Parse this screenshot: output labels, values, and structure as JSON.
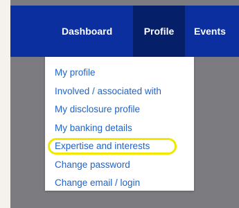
{
  "nav": {
    "items": [
      {
        "label": "Dashboard"
      },
      {
        "label": "Profile",
        "active": true
      },
      {
        "label": "Events"
      }
    ]
  },
  "profile_menu": {
    "items": [
      {
        "label": "My profile"
      },
      {
        "label": "Involved / associated with"
      },
      {
        "label": "My disclosure profile"
      },
      {
        "label": "My banking details"
      },
      {
        "label": "Expertise and interests",
        "highlighted": true
      },
      {
        "label": "Change password"
      },
      {
        "label": "Change email / login"
      }
    ]
  },
  "colors": {
    "nav_background": "#0b2f9e",
    "nav_active_background": "#061f69",
    "link": "#1f63c9",
    "highlight_ring": "#f5e600",
    "page_overlay": "#7c7c80"
  }
}
